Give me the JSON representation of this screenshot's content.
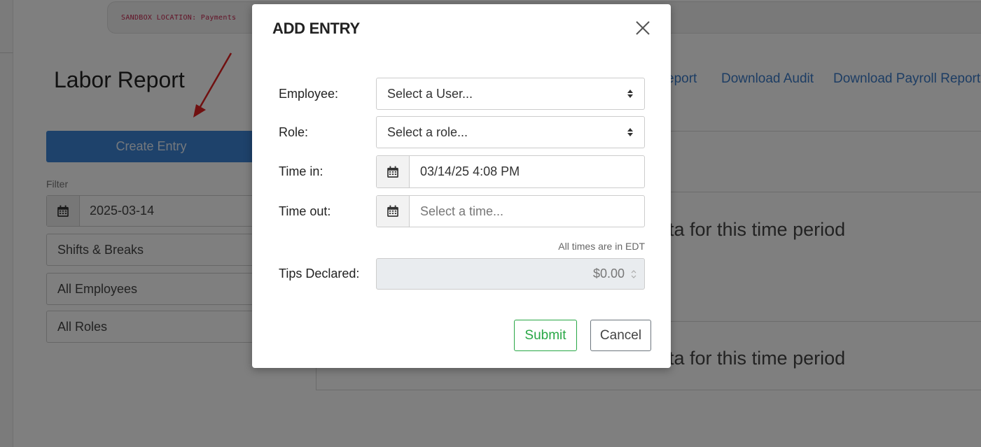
{
  "sandbox": {
    "text": "SANDBOX LOCATION: Payments"
  },
  "page": {
    "title": "Labor Report",
    "create_entry_label": "Create Entry",
    "filter_label": "Filter",
    "filter_date": "2025-03-14",
    "type_select": "Shifts & Breaks",
    "employee_select": "All Employees",
    "role_select": "All Roles"
  },
  "links": {
    "report_partial": "eport",
    "download_audit": "Download Audit",
    "download_payroll": "Download Payroll Report"
  },
  "panels": {
    "no_data_1": "ata for this time period",
    "no_data_2": "ata for this time period"
  },
  "modal": {
    "title": "ADD ENTRY",
    "employee_label": "Employee:",
    "employee_value": "Select a User...",
    "role_label": "Role:",
    "role_value": "Select a role...",
    "time_in_label": "Time in:",
    "time_in_value": "03/14/25 4:08 PM",
    "time_out_label": "Time out:",
    "time_out_placeholder": "Select a time...",
    "timezone_note": "All times are in EDT",
    "tips_label": "Tips Declared:",
    "tips_value": "$0.00",
    "submit_label": "Submit",
    "cancel_label": "Cancel"
  },
  "icons": {
    "calendar": "calendar-icon",
    "close": "close-icon",
    "select_caret": "sort-caret-icon",
    "spinner": "spinner-arrows-icon"
  },
  "colors": {
    "primary": "#3c84d6",
    "success": "#28a745",
    "link": "#3a7bc8",
    "sandbox_text": "#c7254e"
  }
}
